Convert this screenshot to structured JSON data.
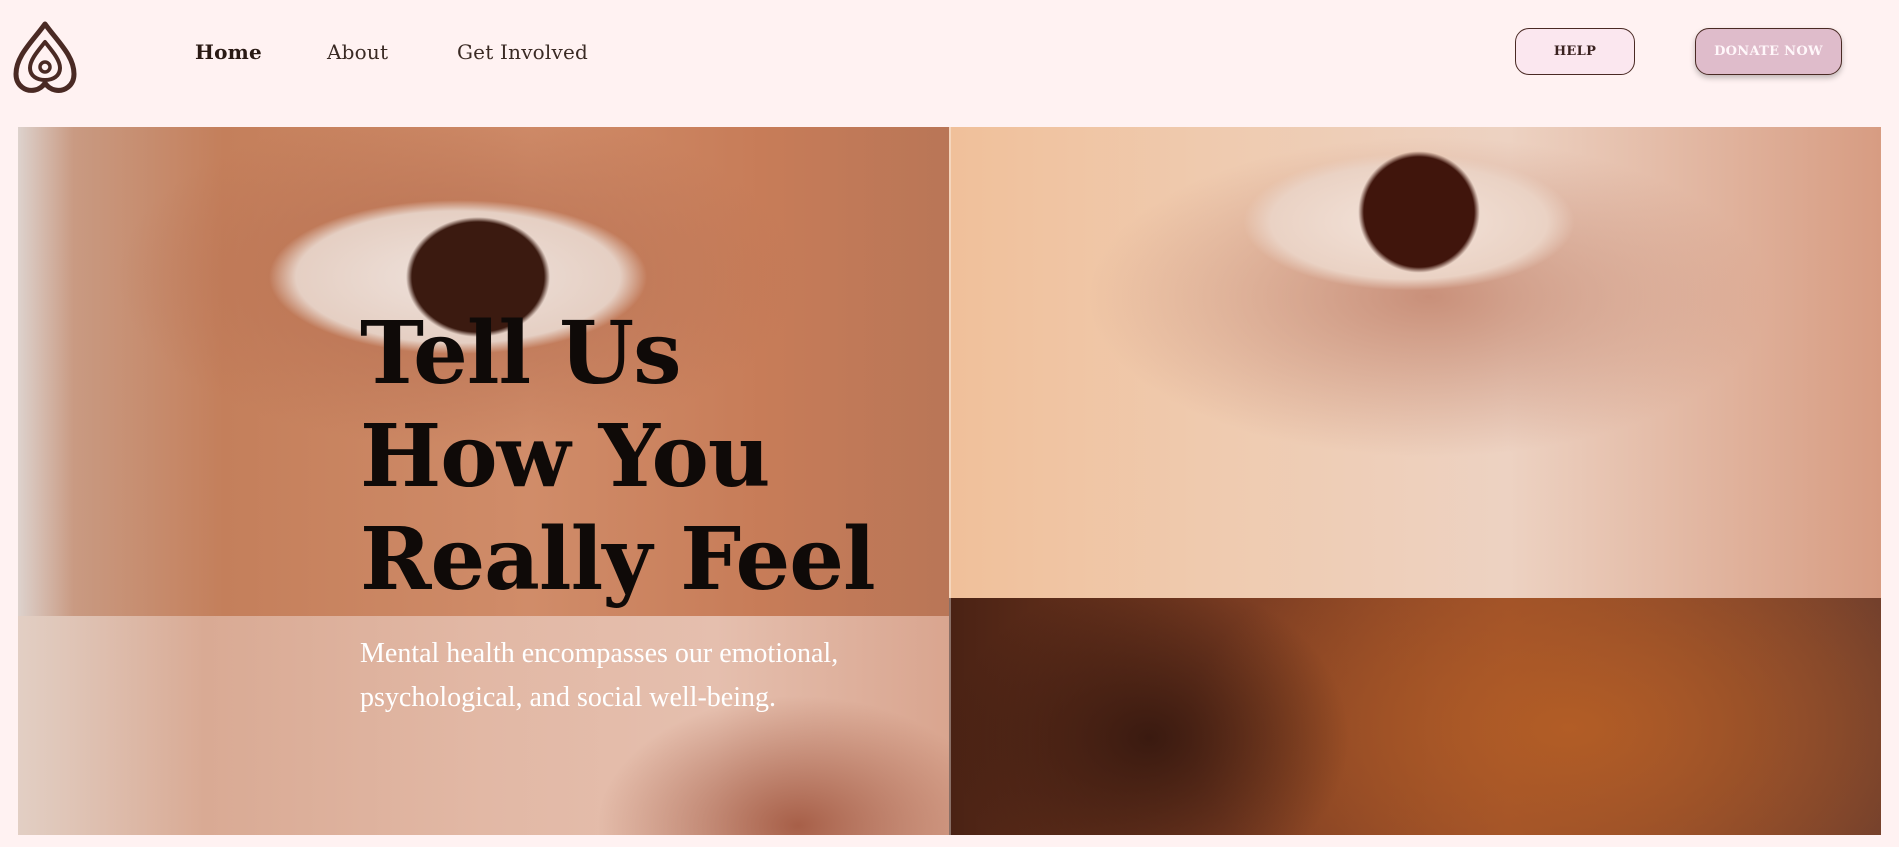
{
  "header": {
    "logo_icon": "heart-droplet-logo-icon",
    "nav": [
      {
        "label": "Home",
        "active": true
      },
      {
        "label": "About",
        "active": false
      },
      {
        "label": "Get Involved",
        "active": false
      }
    ],
    "help_label": "HELP",
    "donate_label": "DONATE NOW"
  },
  "hero": {
    "title_lines": [
      "Tell Us",
      "How You",
      "Really Feel"
    ],
    "subtitle": "Mental health encompasses our emotional, psychological, and social well-being."
  },
  "colors": {
    "background": "#fff2f2",
    "brand_dark": "#4a2a24",
    "donate_fill": "#dfbccb",
    "help_fill": "#fbe7ef"
  }
}
